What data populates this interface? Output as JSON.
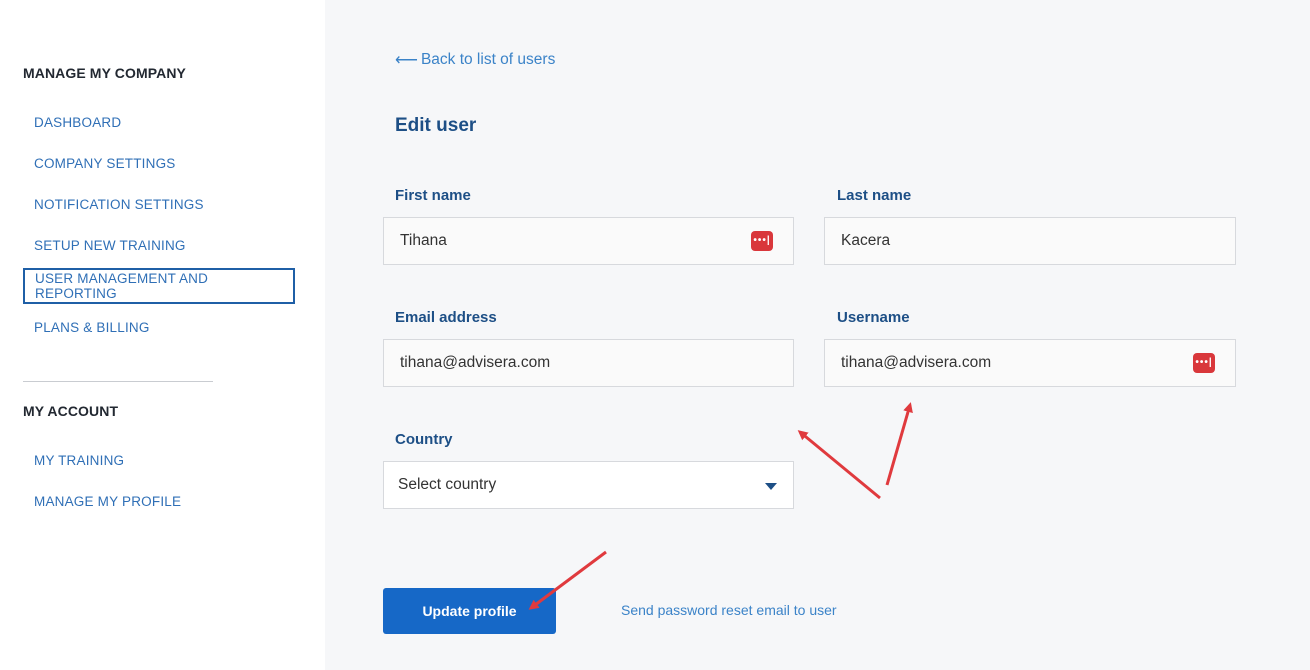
{
  "sidebar": {
    "company_title": "MANAGE MY COMPANY",
    "company_items": [
      {
        "label": "DASHBOARD"
      },
      {
        "label": "COMPANY SETTINGS"
      },
      {
        "label": "NOTIFICATION SETTINGS"
      },
      {
        "label": "SETUP NEW TRAINING"
      },
      {
        "label": "USER MANAGEMENT AND REPORTING",
        "active": true
      },
      {
        "label": "PLANS & BILLING"
      }
    ],
    "account_title": "MY ACCOUNT",
    "account_items": [
      {
        "label": "MY TRAINING"
      },
      {
        "label": "MANAGE MY PROFILE"
      }
    ]
  },
  "main": {
    "back_link": "Back to list of users",
    "back_icon": "arrow-left-icon",
    "title": "Edit user",
    "fields": {
      "first_name": {
        "label": "First name",
        "value": "Tihana"
      },
      "last_name": {
        "label": "Last name",
        "value": "Kacera"
      },
      "email": {
        "label": "Email address",
        "value": "tihana@advisera.com"
      },
      "username": {
        "label": "Username",
        "value": "tihana@advisera.com"
      },
      "country": {
        "label": "Country",
        "value": "Select country"
      }
    },
    "password_icon_glyph": "•••|",
    "update_button": "Update profile",
    "reset_link": "Send password reset email to user"
  },
  "colors": {
    "accent": "#1668c7",
    "link": "#3b83c8",
    "heading": "#1d4f86",
    "annotation": "#e03a3e"
  }
}
